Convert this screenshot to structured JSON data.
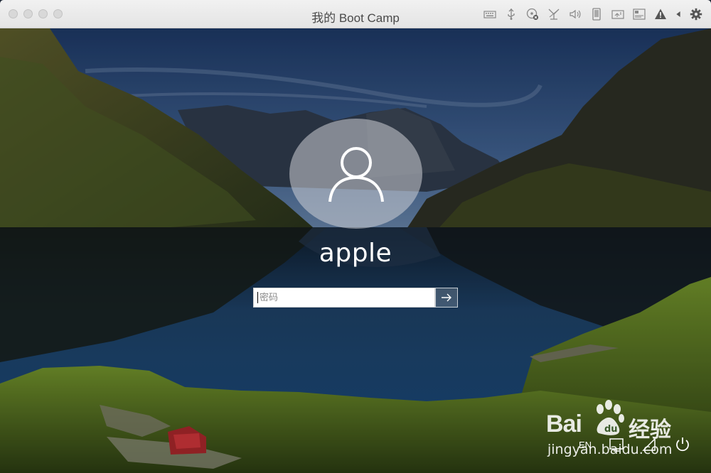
{
  "window": {
    "title": "我的 Boot Camp"
  },
  "toolbar_icons": [
    "keyboard-icon",
    "usb-icon",
    "cd-disabled-icon",
    "network-icon",
    "sound-icon",
    "phone-icon",
    "shared-folder-icon",
    "display-icon",
    "warning-icon",
    "collapse-arrow-icon",
    "gear-icon"
  ],
  "login": {
    "username": "apple",
    "password_placeholder": "密码",
    "password_value": ""
  },
  "bottom_bar": {
    "language": "EN"
  },
  "watermark": {
    "brand": "Bai",
    "brand_suffix": "经验",
    "url": "jingyan.baidu.com"
  },
  "colors": {
    "titlebar": "#e8e8e8",
    "sky": "#2b4a78",
    "lake": "#20456f",
    "grass": "#5f7d1f"
  }
}
